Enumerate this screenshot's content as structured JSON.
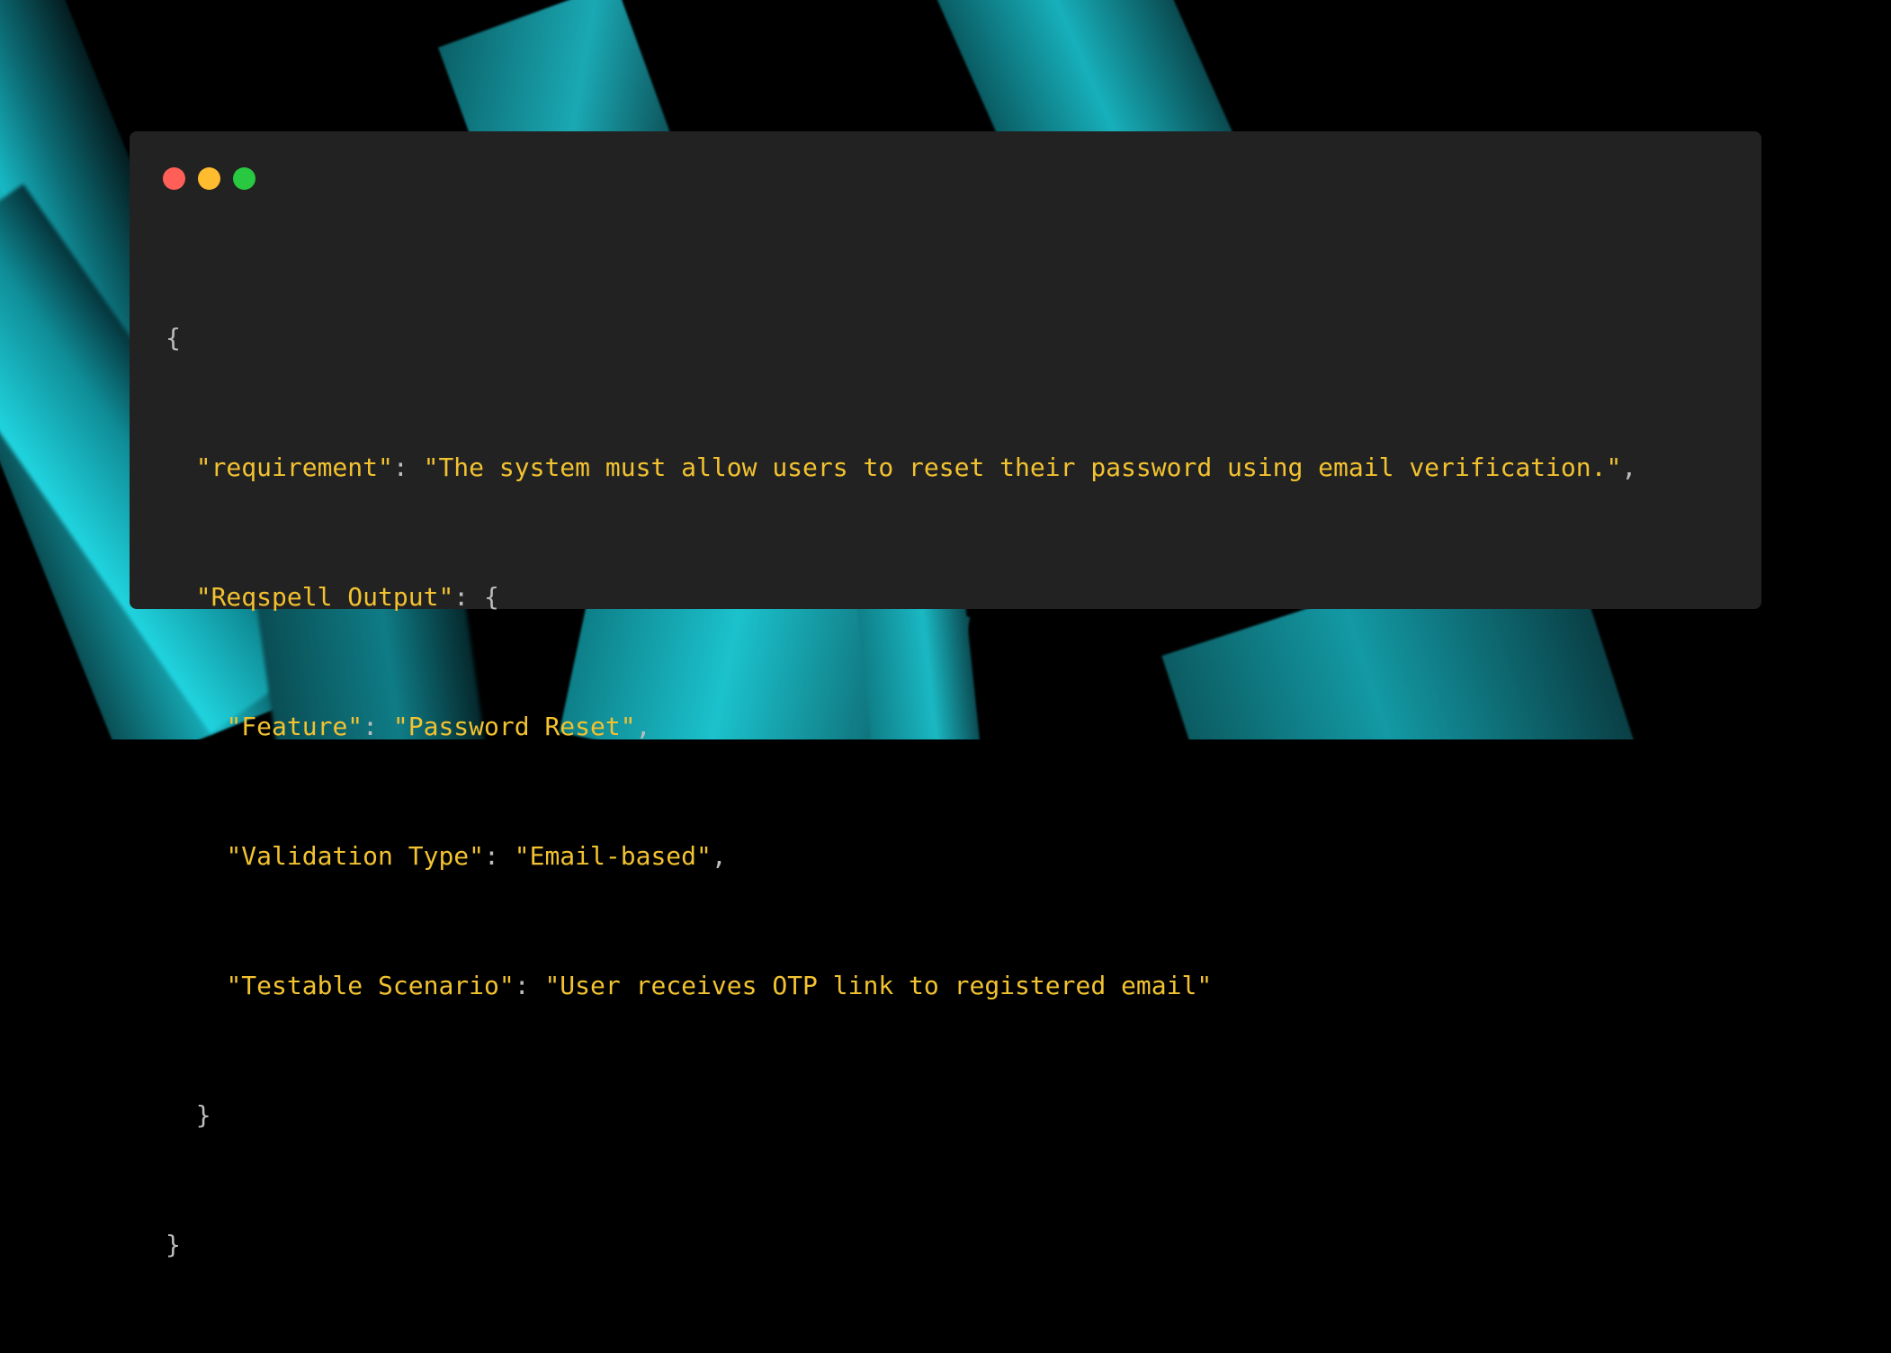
{
  "colors": {
    "window_background": "#222222",
    "page_background": "#000000",
    "accent_teal": "#17b8c4",
    "json_token": "#f2c230",
    "punctuation": "#bdbdbd",
    "dot_close": "#ff5f57",
    "dot_minimize": "#febc2e",
    "dot_maximize": "#28c840"
  },
  "window": {
    "controls": [
      "close-dot",
      "minimize-dot",
      "maximize-dot"
    ]
  },
  "code": {
    "open_brace": "{",
    "requirement_key": "\"requirement\"",
    "requirement_value": "\"The system must allow users to reset their password using email verification.\"",
    "reqspell_key": "\"Reqspell Output\"",
    "feature_key": "\"Feature\"",
    "feature_value": "\"Password Reset\"",
    "validation_key": "\"Validation Type\"",
    "validation_value": "\"Email-based\"",
    "scenario_key": "\"Testable Scenario\"",
    "scenario_value": "\"User receives OTP link to registered email\"",
    "inner_close_brace": "}",
    "close_brace": "}"
  }
}
